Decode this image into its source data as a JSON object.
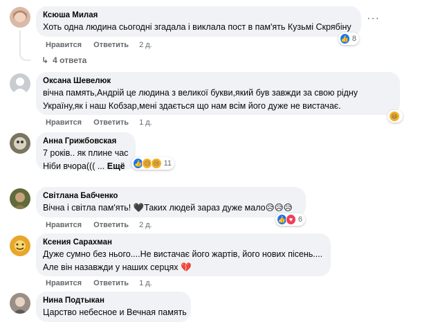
{
  "comments": [
    {
      "author": "Ксюша Милая",
      "lines": [
        "Хоть одна людина сьогодні згадала і виклала пост в пам'ять Кузьмі Скрябіну"
      ],
      "like_label": "Нравится",
      "reply_label": "Ответить",
      "time": "2 д.",
      "reaction_count": "8",
      "reaction_icons": [
        "like-icon"
      ],
      "replies_label": "4 ответа"
    },
    {
      "author": "Оксана Шевелюк",
      "lines": [
        "вічна память,Андрій це людина з великої букви,який був завжди за свою рідну",
        "Україну,як і наш Кобзар,мені здається що нам всім його дуже не вистачає."
      ],
      "like_label": "Нравится",
      "reply_label": "Ответить",
      "time": "1 д.",
      "reaction_icons": [
        "haha-icon"
      ]
    },
    {
      "author": "Анна Грижбовская",
      "lines": [
        "7 років.. як плине час",
        "Ніби вчора((( ..."
      ],
      "see_more": "Ещё",
      "reaction_count": "11",
      "reaction_icons": [
        "like-icon",
        "sad-icon",
        "sad-icon"
      ]
    },
    {
      "author": "Світлана Бабченко",
      "lines": [
        "Вічна і світла пам'ять! 🖤Таких людей зараз дуже мало😥😥😥"
      ],
      "like_label": "Нравится",
      "reply_label": "Ответить",
      "time": "2 д.",
      "reaction_count": "6",
      "reaction_icons": [
        "like-icon",
        "heart-icon"
      ]
    },
    {
      "author": "Ксения Сарахман",
      "lines": [
        "Дуже сумно без нього....Не вистачає його жартів, його нових пісень....",
        "Але він назавжди у наших серцях 💔"
      ],
      "like_label": "Нравится",
      "reply_label": "Ответить",
      "time": "1 д."
    },
    {
      "author": "Нина Подтыкан",
      "lines": [
        "Царство небесное и Вечная память"
      ]
    }
  ],
  "icons": {
    "more": "more-options-icon",
    "reply_arrow": "reply-arrow-icon"
  },
  "colors": {
    "like": "#1877f2",
    "heart": "#f33e58",
    "bubble": "#f0f2f5",
    "meta": "#65676b"
  }
}
